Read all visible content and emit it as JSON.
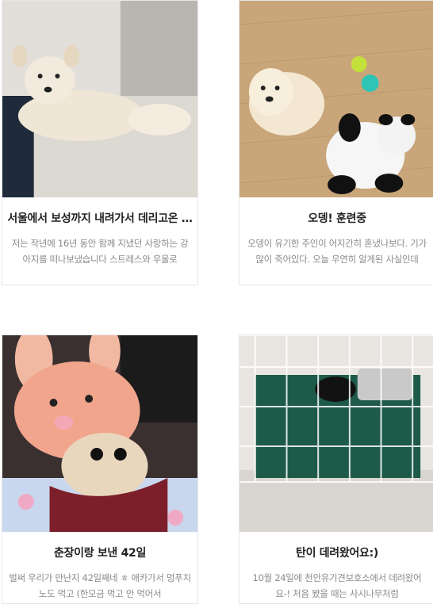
{
  "posts": [
    {
      "title": "서울에서 보성까지 내려가서 데리고온 …",
      "excerpt": "저는 작년에 16년 동안 함께 지냈던 사랑하는 강아지를 떠나보냈습니다 스트레스와 우울로",
      "image": "photo-white-dog-lying-on-floor"
    },
    {
      "title": "오뎅! 훈련중",
      "excerpt": "오뎅이 유기한 주인이 어지간히 혼냈나보다. 기가 많이 죽어있다. 오늘 우연히 알게된 사실인데",
      "image": "photo-dog-with-toy-ball-and-panda-plush"
    },
    {
      "title": "춘장이랑 보낸 42일",
      "excerpt": "벌써 우리가 만난지 42일째네 ㅎ 애카가서 멍푸치노도 먹고 (한모금 먹고 안 먹어서",
      "image": "photo-chihuahua-in-pink-bunny-hat"
    },
    {
      "title": "탄이 데려왔어요:)",
      "excerpt": "10월 24일에 천안유기견보호소에서 데려왔어요-! 처음 봤을 때는 사시나무처럼",
      "image": "photo-black-puppy-in-wire-playpen"
    }
  ]
}
